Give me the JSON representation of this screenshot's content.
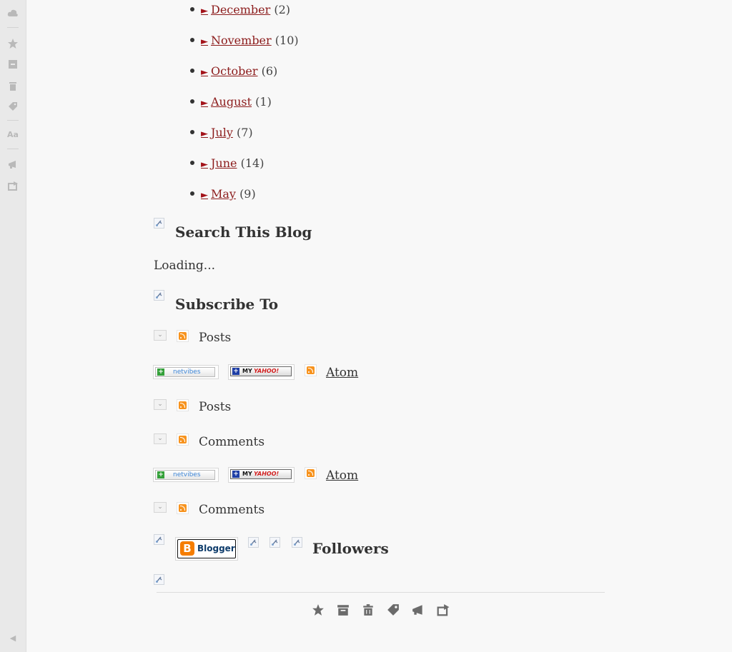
{
  "archive": {
    "items": [
      {
        "label": "December",
        "count": "(2)"
      },
      {
        "label": "November",
        "count": "(10)"
      },
      {
        "label": "October",
        "count": "(6)"
      },
      {
        "label": "August",
        "count": "(1)"
      },
      {
        "label": "July",
        "count": "(7)"
      },
      {
        "label": "June",
        "count": "(14)"
      },
      {
        "label": "May",
        "count": "(9)"
      }
    ],
    "toggle_glyph": "►"
  },
  "search_widget": {
    "title": "Search This Blog",
    "status": "Loading..."
  },
  "subscribe_widget": {
    "title": "Subscribe To",
    "posts_label": "Posts",
    "comments_label": "Comments",
    "atom_label": "Atom",
    "netvibes_label": "netvibes",
    "netvibes_plus": "+",
    "yahoo_plus": "+",
    "yahoo_my": "MY",
    "yahoo_label": "YAHOO!"
  },
  "followers_widget": {
    "title": "Followers",
    "blogger_label": "Blogger",
    "blogger_logo": "B"
  },
  "toggle_glyph": "⌄",
  "sidebar": {
    "font_icon_label": "Aa",
    "collapse_glyph": "◀"
  },
  "colors": {
    "link": "#8c1c1c",
    "arrow": "#a3131a",
    "rss": "#f7931e",
    "blogger": "#f57d00"
  }
}
